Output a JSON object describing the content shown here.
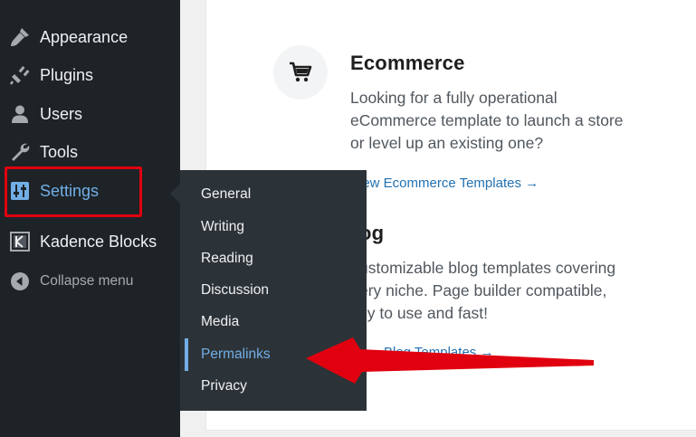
{
  "sidebar": {
    "items": [
      {
        "label": "Appearance",
        "icon": "paintbrush-icon"
      },
      {
        "label": "Plugins",
        "icon": "plugin-icon"
      },
      {
        "label": "Users",
        "icon": "user-icon"
      },
      {
        "label": "Tools",
        "icon": "wrench-icon"
      },
      {
        "label": "Settings",
        "icon": "settings-sliders-icon"
      },
      {
        "label": "Kadence Blocks",
        "icon": "kadence-icon"
      }
    ],
    "collapse_label": "Collapse menu"
  },
  "settings_submenu": {
    "items": [
      "General",
      "Writing",
      "Reading",
      "Discussion",
      "Media",
      "Permalinks",
      "Privacy"
    ],
    "current": "Permalinks"
  },
  "content": {
    "ecommerce": {
      "title": "Ecommerce",
      "desc_lines": [
        "Looking for a fully operational",
        "eCommerce template to launch a store",
        "or level up an existing one?"
      ],
      "link": "iew Ecommerce Templates →"
    },
    "blog": {
      "title": "og",
      "desc_lines": [
        "ustomizable blog templates covering",
        "ery niche. Page builder compatible,",
        "sy to use and fast!"
      ],
      "link": "Blog Templates →"
    }
  },
  "colors": {
    "sidebar_bg": "#1d2327",
    "flyout_bg": "#2c3338",
    "accent": "#72aee6",
    "annotation_red": "#e0000f",
    "link_blue": "#2271b1"
  }
}
